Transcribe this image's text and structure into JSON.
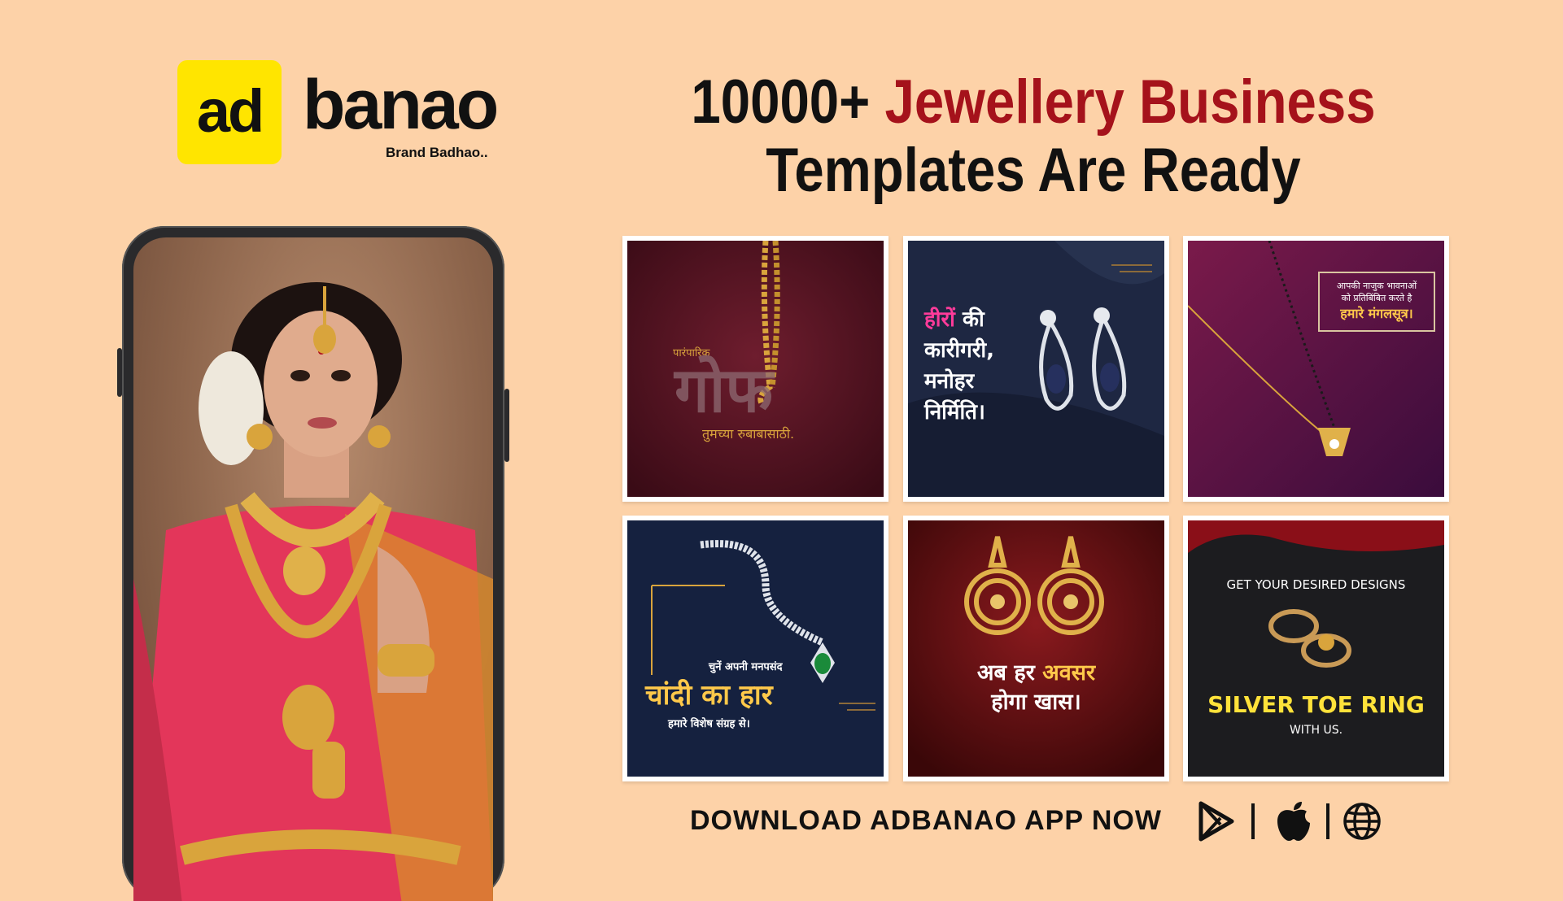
{
  "brand": {
    "logo_ad": "ad",
    "logo_word": "banao",
    "tagline": "Brand Badhao.."
  },
  "headline": {
    "prefix": "10000+ ",
    "highlight": "Jewellery Business",
    "line2": "Templates Are Ready"
  },
  "templates": [
    {
      "id": "gof",
      "small": "पारंपारिक",
      "big": "गोफ",
      "caption": "तुमच्या रुबाबासाठी."
    },
    {
      "id": "diamond-earrings",
      "line1_highlight": "हीरों",
      "line1_rest": " की",
      "line2": "कारीगरी,",
      "line3": "मनोहर",
      "line4": "निर्मिति।"
    },
    {
      "id": "mangalsutra",
      "line1": "आपकी नाजुक भावनाओं",
      "line2": "को प्रतिबिंबित करते है",
      "line3": "हमारे मंगलसूत्र।"
    },
    {
      "id": "silver-necklace",
      "line1": "चुनें अपनी मनपसंद",
      "line2": "चांदी का हार",
      "line3": "हमारे विशेष संग्रह से।"
    },
    {
      "id": "gold-earrings",
      "line1_plain": "अब हर ",
      "line1_highlight": "अवसर",
      "line2": "होगा खास।"
    },
    {
      "id": "toe-ring",
      "top": "GET YOUR DESIRED DESIGNS",
      "title": "SILVER TOE RING",
      "sub": "WITH US."
    }
  ],
  "footer": {
    "download_text": "DOWNLOAD ADBANAO APP NOW",
    "icons": [
      "play-store-icon",
      "apple-icon",
      "globe-icon"
    ]
  },
  "colors": {
    "background": "#fdd2a8",
    "logo_yellow": "#ffe500",
    "headline_red": "#a5121b",
    "gold": "#e0b14a"
  }
}
